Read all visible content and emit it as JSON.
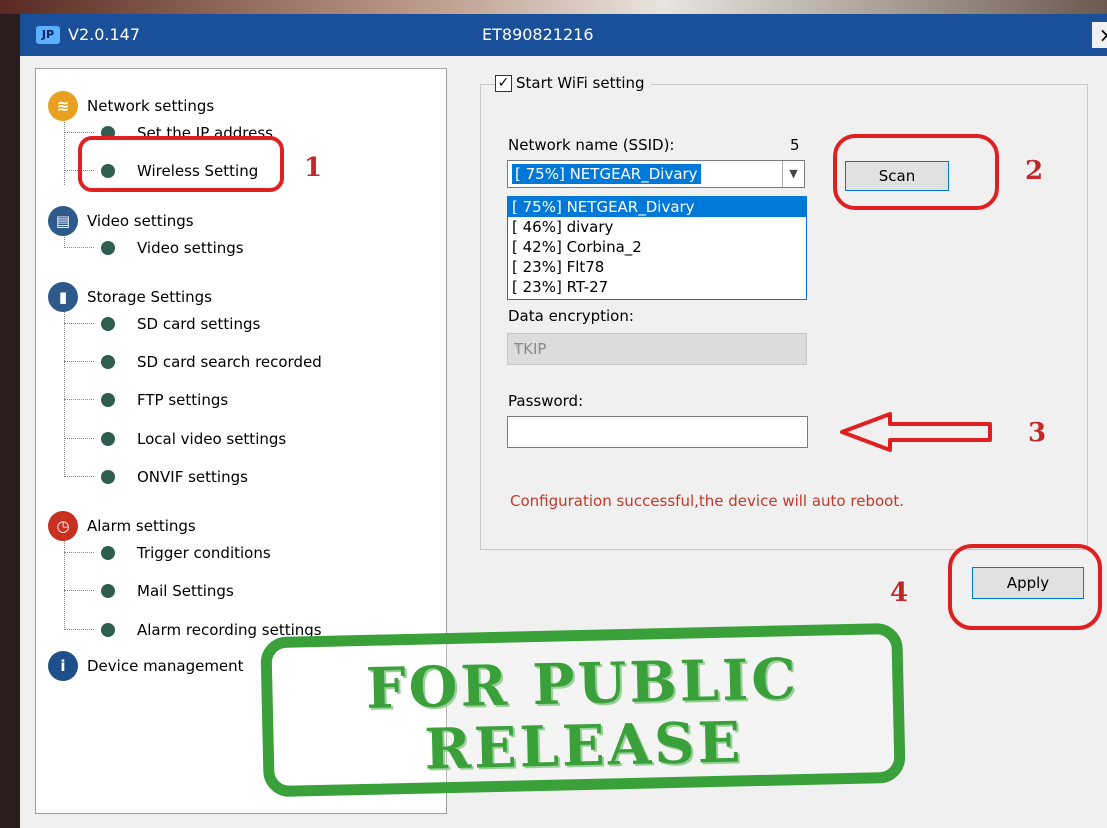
{
  "title_bar": {
    "version": "V2.0.147",
    "device_id": "ET890821216",
    "close": "×"
  },
  "tree": {
    "categories": [
      {
        "label": "Network settings",
        "icon": "wifi-icon",
        "color": "#e8a020",
        "items": [
          "Set the IP address",
          "Wireless Setting"
        ]
      },
      {
        "label": "Video settings",
        "icon": "video-icon",
        "color": "#2d5a8a",
        "items": [
          "Video settings"
        ]
      },
      {
        "label": "Storage Settings",
        "icon": "storage-icon",
        "color": "#2d5a8a",
        "items": [
          "SD card settings",
          "SD card search recorded",
          "FTP settings",
          "Local video settings",
          "ONVIF settings"
        ]
      },
      {
        "label": "Alarm settings",
        "icon": "alarm-clock-icon",
        "color": "#c83020",
        "items": [
          "Trigger conditions",
          "Mail Settings",
          "Alarm recording settings"
        ]
      },
      {
        "label": "Device management",
        "icon": "info-icon",
        "color": "#1f4f8a",
        "items": []
      }
    ]
  },
  "wifi": {
    "start_label": "Start WiFi setting",
    "checked": true,
    "ssid_label": "Network name (SSID):",
    "ssid_count": "5",
    "selected_network": "[ 75%] NETGEAR_Divary",
    "networks": [
      "[ 75%] NETGEAR_Divary",
      "[ 46%] divary",
      "[ 42%] Corbina_2",
      "[ 23%] Flt78",
      "[ 23%] RT-27"
    ],
    "scan_label": "Scan",
    "encryption_label": "Data encryption:",
    "encryption_value": "TKIP",
    "password_label": "Password:",
    "password_value": "",
    "status_message": "Configuration successful,the device will auto reboot.",
    "apply_label": "Apply"
  },
  "annotations": {
    "step1": "1",
    "step2": "2",
    "step3": "3",
    "step4": "4",
    "color": "#e02020"
  },
  "stamp": {
    "line1": "FOR PUBLIC",
    "line2": "RELEASE",
    "color": "#3aa03a"
  }
}
